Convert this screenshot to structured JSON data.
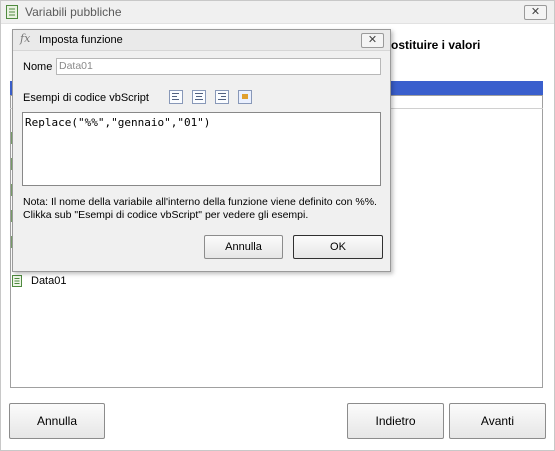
{
  "window": {
    "title": "Variabili pubbliche",
    "close_label": "✕",
    "header_text": "ostituire i valori"
  },
  "list": {
    "items": [
      {
        "label": "Data01",
        "icon": "document-icon"
      }
    ]
  },
  "buttons": {
    "annulla": "Annulla",
    "indietro": "Indietro",
    "avanti": "Avanti"
  },
  "dialog": {
    "title": "Imposta funzione",
    "title_icon": "fx",
    "close_label": "✕",
    "nome_label": "Nome",
    "nome_value": "Data01",
    "esempi_label": "Esempi di codice vbScript",
    "toolbar_icons": [
      "align-left-icon",
      "align-center-icon",
      "align-right-icon",
      "image-icon"
    ],
    "code": "Replace(\"%%\",\"gennaio\",\"01\")",
    "note_line1": "Nota: Il nome della variabile all'interno della funzione viene definito con %%.",
    "note_line2": "Clikka sub \"Esempi di codice vbScript\" per vedere gli esempi.",
    "annulla": "Annulla",
    "ok": "OK"
  },
  "colors": {
    "accent_band": "#3a5fcd",
    "dialog_bg": "#f0f0f0"
  }
}
